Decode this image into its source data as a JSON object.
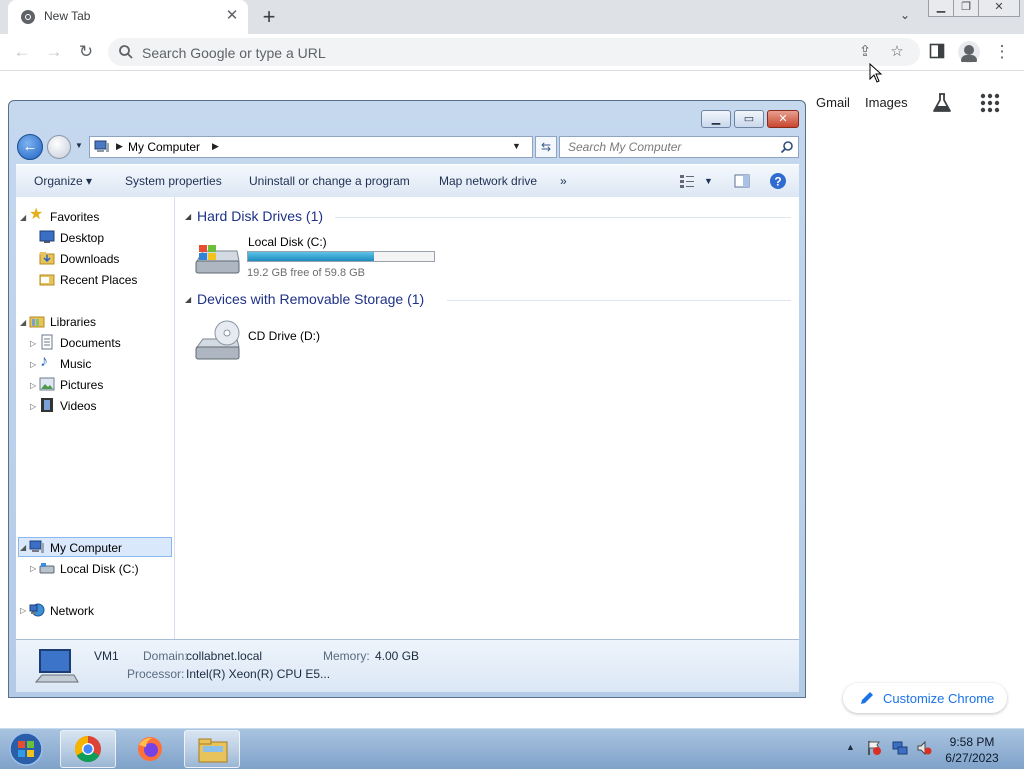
{
  "browser": {
    "tab_title": "New Tab",
    "omnibox_placeholder": "Search Google or type a URL",
    "ntp_links": {
      "gmail": "Gmail",
      "images": "Images"
    },
    "customize_label": "Customize Chrome"
  },
  "explorer": {
    "address_text": "My Computer",
    "search_placeholder": "Search My Computer",
    "commands": {
      "organize": "Organize",
      "system_properties": "System properties",
      "uninstall": "Uninstall or change a program",
      "map_drive": "Map network drive",
      "more": "»"
    },
    "tree": {
      "favorites": "Favorites",
      "desktop": "Desktop",
      "downloads": "Downloads",
      "recent_places": "Recent Places",
      "libraries": "Libraries",
      "documents": "Documents",
      "music": "Music",
      "pictures": "Pictures",
      "videos": "Videos",
      "my_computer": "My Computer",
      "local_disk": "Local Disk (C:)",
      "network": "Network"
    },
    "groups": {
      "hard_disks": "Hard Disk Drives (1)",
      "removable": "Devices with Removable Storage (1)"
    },
    "drives": {
      "c_name": "Local Disk (C:)",
      "c_free": "19.2 GB free of 59.8 GB",
      "c_used_fraction": 0.68,
      "d_name": "CD Drive (D:)"
    },
    "details": {
      "computer_name": "VM1",
      "domain_label": "Domain:",
      "domain_value": "collabnet.local",
      "memory_label": "Memory:",
      "memory_value": "4.00 GB",
      "processor_label": "Processor:",
      "processor_value": "Intel(R) Xeon(R) CPU E5..."
    }
  },
  "taskbar": {
    "time": "9:58 PM",
    "date": "6/27/2023"
  },
  "colors": {
    "link_blue": "#1a73e8",
    "explorer_frame": "#b4cbe6",
    "group_title": "#1e3287"
  }
}
